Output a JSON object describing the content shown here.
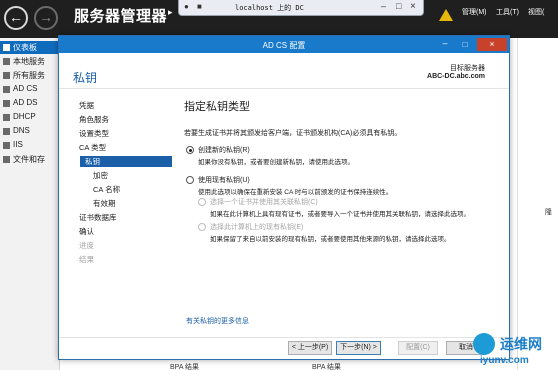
{
  "server_manager": {
    "breadcrumb_title": "服务器管理器",
    "menu": {
      "manage": "管理(M)",
      "tools": "工具(T)",
      "view": "视图("
    },
    "sidebar": [
      {
        "label": "仪表板",
        "selected": true
      },
      {
        "label": "本地服务"
      },
      {
        "label": "所有服务"
      },
      {
        "label": "AD CS"
      },
      {
        "label": "AD DS"
      },
      {
        "label": "DHCP"
      },
      {
        "label": "DNS"
      },
      {
        "label": "IIS"
      },
      {
        "label": "文件和存"
      }
    ],
    "right_fragment": "隆",
    "bottom_fragment_1": "BPA 结果",
    "bottom_fragment_2": "BPA 结果"
  },
  "rdp_bar": {
    "title": "localhost 上的 DC"
  },
  "dialog": {
    "title": "AD CS 配置",
    "heading": "私钥",
    "target_label": "目标服务器",
    "target_value": "ABC-DC.abc.com",
    "nav": [
      {
        "label": "凭据",
        "level": 0,
        "state": "normal"
      },
      {
        "label": "角色服务",
        "level": 0,
        "state": "normal"
      },
      {
        "label": "设置类型",
        "level": 0,
        "state": "normal"
      },
      {
        "label": "CA 类型",
        "level": 0,
        "state": "normal"
      },
      {
        "label": "私钥",
        "level": 0,
        "state": "selected"
      },
      {
        "label": "加密",
        "level": 1,
        "state": "normal"
      },
      {
        "label": "CA 名称",
        "level": 1,
        "state": "normal"
      },
      {
        "label": "有效期",
        "level": 1,
        "state": "normal"
      },
      {
        "label": "证书数据库",
        "level": 0,
        "state": "normal"
      },
      {
        "label": "确认",
        "level": 0,
        "state": "normal"
      },
      {
        "label": "进度",
        "level": 0,
        "state": "disabled"
      },
      {
        "label": "结果",
        "level": 0,
        "state": "disabled"
      }
    ],
    "pane": {
      "title": "指定私钥类型",
      "intro": "若要生成证书并将其颁发给客户端，证书颁发机构(CA)必须具有私钥。",
      "option_new": {
        "label": "创建新的私钥(R)",
        "desc": "如果你没有私钥，或者要创建新私钥，请使用此选项。",
        "checked": true
      },
      "option_existing": {
        "label": "使用现有私钥(U)",
        "desc": "使用此选项以确保在重新安装 CA 时与以前颁发的证书保持连续性。",
        "checked": false
      },
      "sub_option_cert": {
        "label": "选择一个证书并使用其关联私钥(C)",
        "desc": "如果在此计算机上具有现有证书，或者要导入一个证书并使用其关联私钥，请选择此选项。"
      },
      "sub_option_key": {
        "label": "选择此计算机上的现有私钥(E)",
        "desc": "如果保留了来自以前安装的现有私钥，或者要使用其他来源的私钥，请选择此选项。"
      },
      "more_link": "有关私钥的更多信息"
    },
    "buttons": {
      "back": "< 上一步(P)",
      "next": "下一步(N) >",
      "configure": "配置(C)",
      "cancel": "取消"
    }
  },
  "watermark": {
    "brand": "运维网",
    "url": "iyunv.com"
  }
}
